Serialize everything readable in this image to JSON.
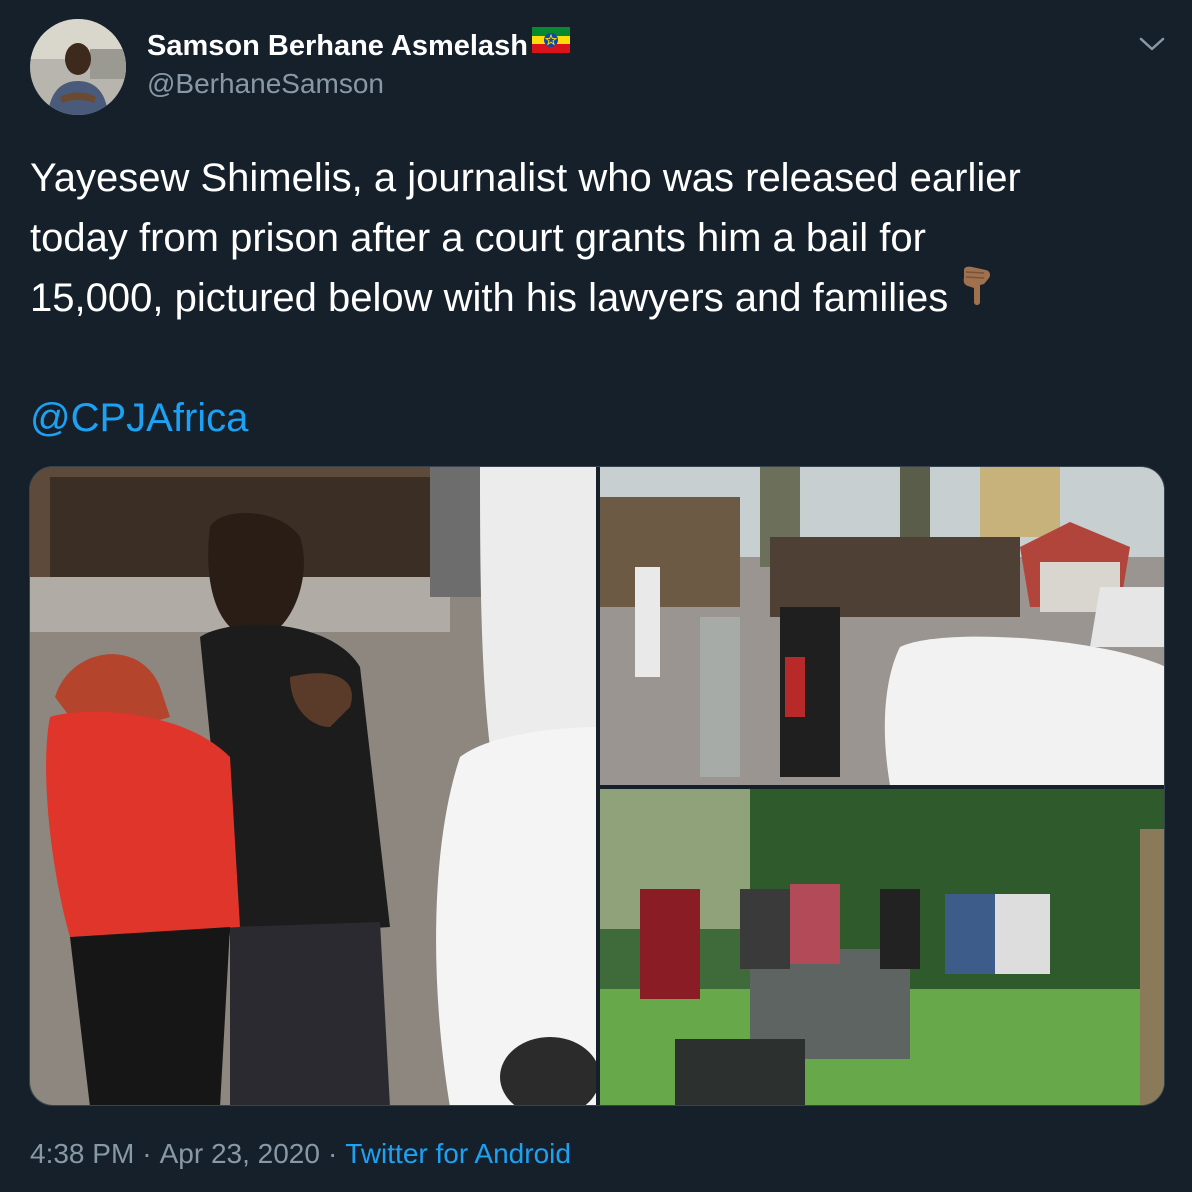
{
  "author": {
    "display_name": "Samson Berhane Asmelash",
    "handle": "@BerhaneSamson",
    "flag_icon": "ethiopia-flag-icon"
  },
  "tweet": {
    "text": "Yayesew Shimelis, a journalist who was released earlier\ntoday from prison after a court grants him a bail for\n15,000, pictured below with his lawyers and families",
    "emoji_icon": "backhand-index-pointing-down-icon",
    "mention": "@CPJAfrica"
  },
  "media": {
    "photo_count": 3
  },
  "footer": {
    "time": "4:38 PM",
    "separator": "·",
    "date": "Apr 23, 2020",
    "source": "Twitter for Android"
  },
  "colors": {
    "background": "#15202b",
    "text": "#ffffff",
    "secondary": "#8899a6",
    "link": "#1da1f2",
    "border": "#38444d"
  }
}
